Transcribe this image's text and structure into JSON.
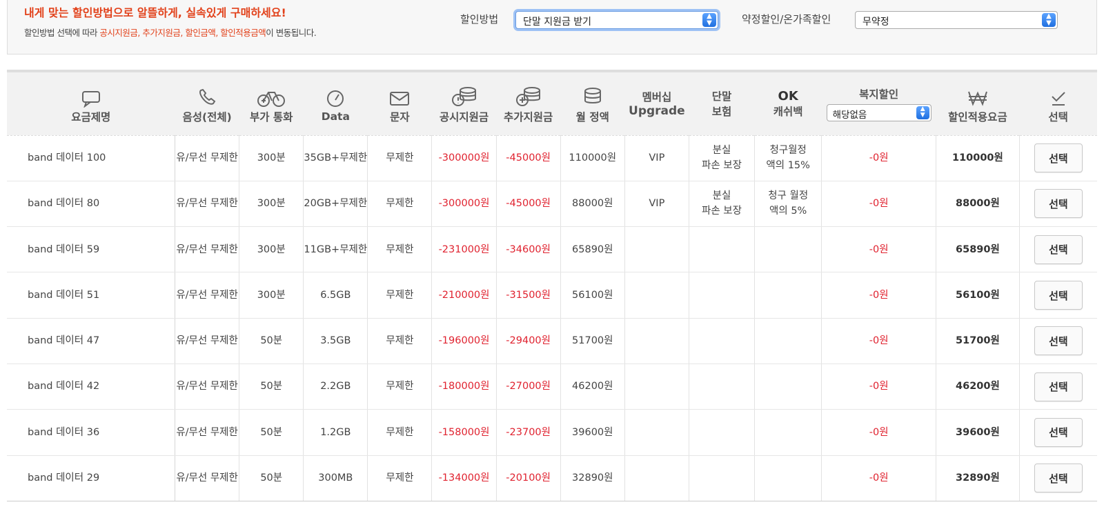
{
  "banner": {
    "headline": "내게 맞는 할인방법으로 알뜰하게, 실속있게 구매하세요!",
    "sub_before": "할인방법 선택에 따라 ",
    "sub_highlight": "공시지원금, 추가지원금, 할인금액, 할인적용금액",
    "sub_after": "이 변동됩니다."
  },
  "controls": {
    "discount_method_label": "할인방법",
    "discount_method_value": "단말 지원금 받기",
    "contract_label": "약정할인/온가족할인",
    "contract_value": "무약정"
  },
  "columns": {
    "plan": "요금제명",
    "voice": "음성(전체)",
    "extra_call": "부가 통화",
    "data": "Data",
    "sms": "문자",
    "public_subsidy": "공시지원금",
    "extra_subsidy": "추가지원금",
    "monthly": "월 정액",
    "membership_1": "멤버십",
    "membership_2": "Upgrade",
    "insurance_1": "단말",
    "insurance_2": "보험",
    "ok_1": "OK",
    "ok_2": "캐쉬백",
    "welfare": "복지할인",
    "welfare_select": "해당없음",
    "discounted_fee": "할인적용요금",
    "select": "선택"
  },
  "rows": [
    {
      "plan": "band 데이터 100",
      "voice": "유/무선 무제한",
      "extra_call": "300분",
      "data": "35GB+무제한",
      "sms": "무제한",
      "public_subsidy": "-300000원",
      "extra_subsidy": "-45000원",
      "monthly": "110000원",
      "membership": "VIP",
      "insurance_1": "분실",
      "insurance_2": "파손 보장",
      "ok_1": "청구월정",
      "ok_2": "액의 15%",
      "welfare": "-0원",
      "final": "110000원",
      "button": "선택"
    },
    {
      "plan": "band 데이터 80",
      "voice": "유/무선 무제한",
      "extra_call": "300분",
      "data": "20GB+무제한",
      "sms": "무제한",
      "public_subsidy": "-300000원",
      "extra_subsidy": "-45000원",
      "monthly": "88000원",
      "membership": "VIP",
      "insurance_1": "분실",
      "insurance_2": "파손 보장",
      "ok_1": "청구 월정",
      "ok_2": "액의 5%",
      "welfare": "-0원",
      "final": "88000원",
      "button": "선택"
    },
    {
      "plan": "band 데이터 59",
      "voice": "유/무선 무제한",
      "extra_call": "300분",
      "data": "11GB+무제한",
      "sms": "무제한",
      "public_subsidy": "-231000원",
      "extra_subsidy": "-34600원",
      "monthly": "65890원",
      "membership": "",
      "insurance_1": "",
      "insurance_2": "",
      "ok_1": "",
      "ok_2": "",
      "welfare": "-0원",
      "final": "65890원",
      "button": "선택"
    },
    {
      "plan": "band 데이터 51",
      "voice": "유/무선 무제한",
      "extra_call": "300분",
      "data": "6.5GB",
      "sms": "무제한",
      "public_subsidy": "-210000원",
      "extra_subsidy": "-31500원",
      "monthly": "56100원",
      "membership": "",
      "insurance_1": "",
      "insurance_2": "",
      "ok_1": "",
      "ok_2": "",
      "welfare": "-0원",
      "final": "56100원",
      "button": "선택"
    },
    {
      "plan": "band 데이터 47",
      "voice": "유/무선 무제한",
      "extra_call": "50분",
      "data": "3.5GB",
      "sms": "무제한",
      "public_subsidy": "-196000원",
      "extra_subsidy": "-29400원",
      "monthly": "51700원",
      "membership": "",
      "insurance_1": "",
      "insurance_2": "",
      "ok_1": "",
      "ok_2": "",
      "welfare": "-0원",
      "final": "51700원",
      "button": "선택"
    },
    {
      "plan": "band 데이터 42",
      "voice": "유/무선 무제한",
      "extra_call": "50분",
      "data": "2.2GB",
      "sms": "무제한",
      "public_subsidy": "-180000원",
      "extra_subsidy": "-27000원",
      "monthly": "46200원",
      "membership": "",
      "insurance_1": "",
      "insurance_2": "",
      "ok_1": "",
      "ok_2": "",
      "welfare": "-0원",
      "final": "46200원",
      "button": "선택"
    },
    {
      "plan": "band 데이터 36",
      "voice": "유/무선 무제한",
      "extra_call": "50분",
      "data": "1.2GB",
      "sms": "무제한",
      "public_subsidy": "-158000원",
      "extra_subsidy": "-23700원",
      "monthly": "39600원",
      "membership": "",
      "insurance_1": "",
      "insurance_2": "",
      "ok_1": "",
      "ok_2": "",
      "welfare": "-0원",
      "final": "39600원",
      "button": "선택"
    },
    {
      "plan": "band 데이터 29",
      "voice": "유/무선 무제한",
      "extra_call": "50분",
      "data": "300MB",
      "sms": "무제한",
      "public_subsidy": "-134000원",
      "extra_subsidy": "-20100원",
      "monthly": "32890원",
      "membership": "",
      "insurance_1": "",
      "insurance_2": "",
      "ok_1": "",
      "ok_2": "",
      "welfare": "-0원",
      "final": "32890원",
      "button": "선택"
    }
  ],
  "icons": {
    "plan": "speech-bubble-icon",
    "voice": "phone-icon",
    "extra_call": "bicycle-icon",
    "data": "gauge-icon",
    "sms": "envelope-icon",
    "public_subsidy": "coins-info-icon",
    "extra_subsidy": "coins-plus-icon",
    "monthly": "coins-icon",
    "discounted_fee": "won-icon",
    "select": "check-icon"
  },
  "colors": {
    "accent": "#e2411a",
    "negative": "#e0222f",
    "select_arrow": "#1f6fe0"
  }
}
